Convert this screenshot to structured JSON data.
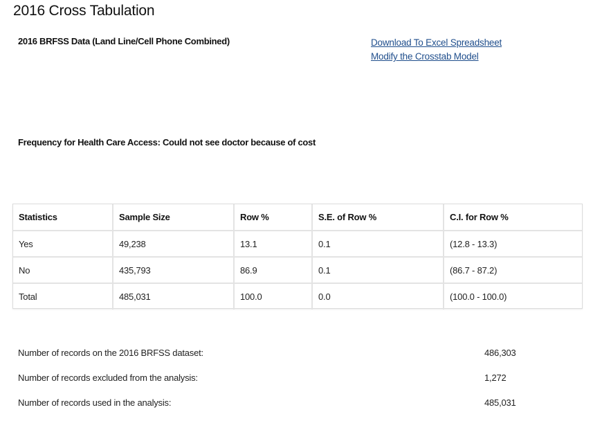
{
  "page": {
    "title": "2016 Cross Tabulation",
    "dataset_label": "2016 BRFSS Data (Land Line/Cell Phone Combined)"
  },
  "links": {
    "download": "Download To Excel Spreadsheet",
    "modify": "Modify the Crosstab Model"
  },
  "frequency_heading": "Frequency for Health Care Access: Could not see doctor because of cost",
  "table": {
    "headers": [
      "Statistics",
      "Sample Size",
      "Row %",
      "S.E. of Row %",
      "C.I. for Row %"
    ],
    "rows": [
      [
        "Yes",
        "49,238",
        "13.1",
        "0.1",
        "(12.8 - 13.3)"
      ],
      [
        "No",
        "435,793",
        "86.9",
        "0.1",
        "(86.7 - 87.2)"
      ],
      [
        "Total",
        "485,031",
        "100.0",
        "0.0",
        "(100.0 - 100.0)"
      ]
    ]
  },
  "summary": [
    {
      "label": "Number of records on the 2016 BRFSS dataset:",
      "value": "486,303"
    },
    {
      "label": "Number of records excluded from the analysis:",
      "value": "1,272"
    },
    {
      "label": "Number of records used in the analysis:",
      "value": "485,031"
    }
  ],
  "colors": {
    "link": "#1f4e8c",
    "border": "#e3e3e3",
    "text": "#222222"
  }
}
